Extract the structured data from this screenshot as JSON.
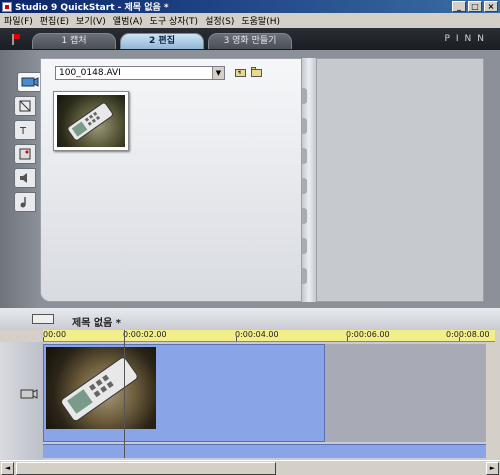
{
  "window": {
    "title": "Studio 9 QuickStart - 제목 없음 *"
  },
  "menu": [
    "파일(F)",
    "편집(E)",
    "보기(V)",
    "앨범(A)",
    "도구 상자(T)",
    "설정(S)",
    "도움말(H)"
  ],
  "tabs": {
    "capture": "1 캡처",
    "edit": "2 편집",
    "make_movie": "3 영화 만들기",
    "active": "edit"
  },
  "brand": "PINN",
  "album": {
    "file_selector": "100_0148.AVI",
    "side_tabs": [
      "video-scenes-icon",
      "transitions-icon",
      "titles-icon",
      "still-images-icon",
      "sound-effects-icon",
      "music-icon"
    ]
  },
  "timeline": {
    "project_title": "제목 없음 *",
    "ruler_labels": [
      "00:00",
      "0:00:02.00",
      "0:00:04.00",
      "0:00:06.00",
      "0:00:08.00"
    ]
  },
  "colors": {
    "ruler": "#f2ee8a",
    "video_track": "#8aa4e8",
    "active_tab": "#8fb6d6"
  }
}
